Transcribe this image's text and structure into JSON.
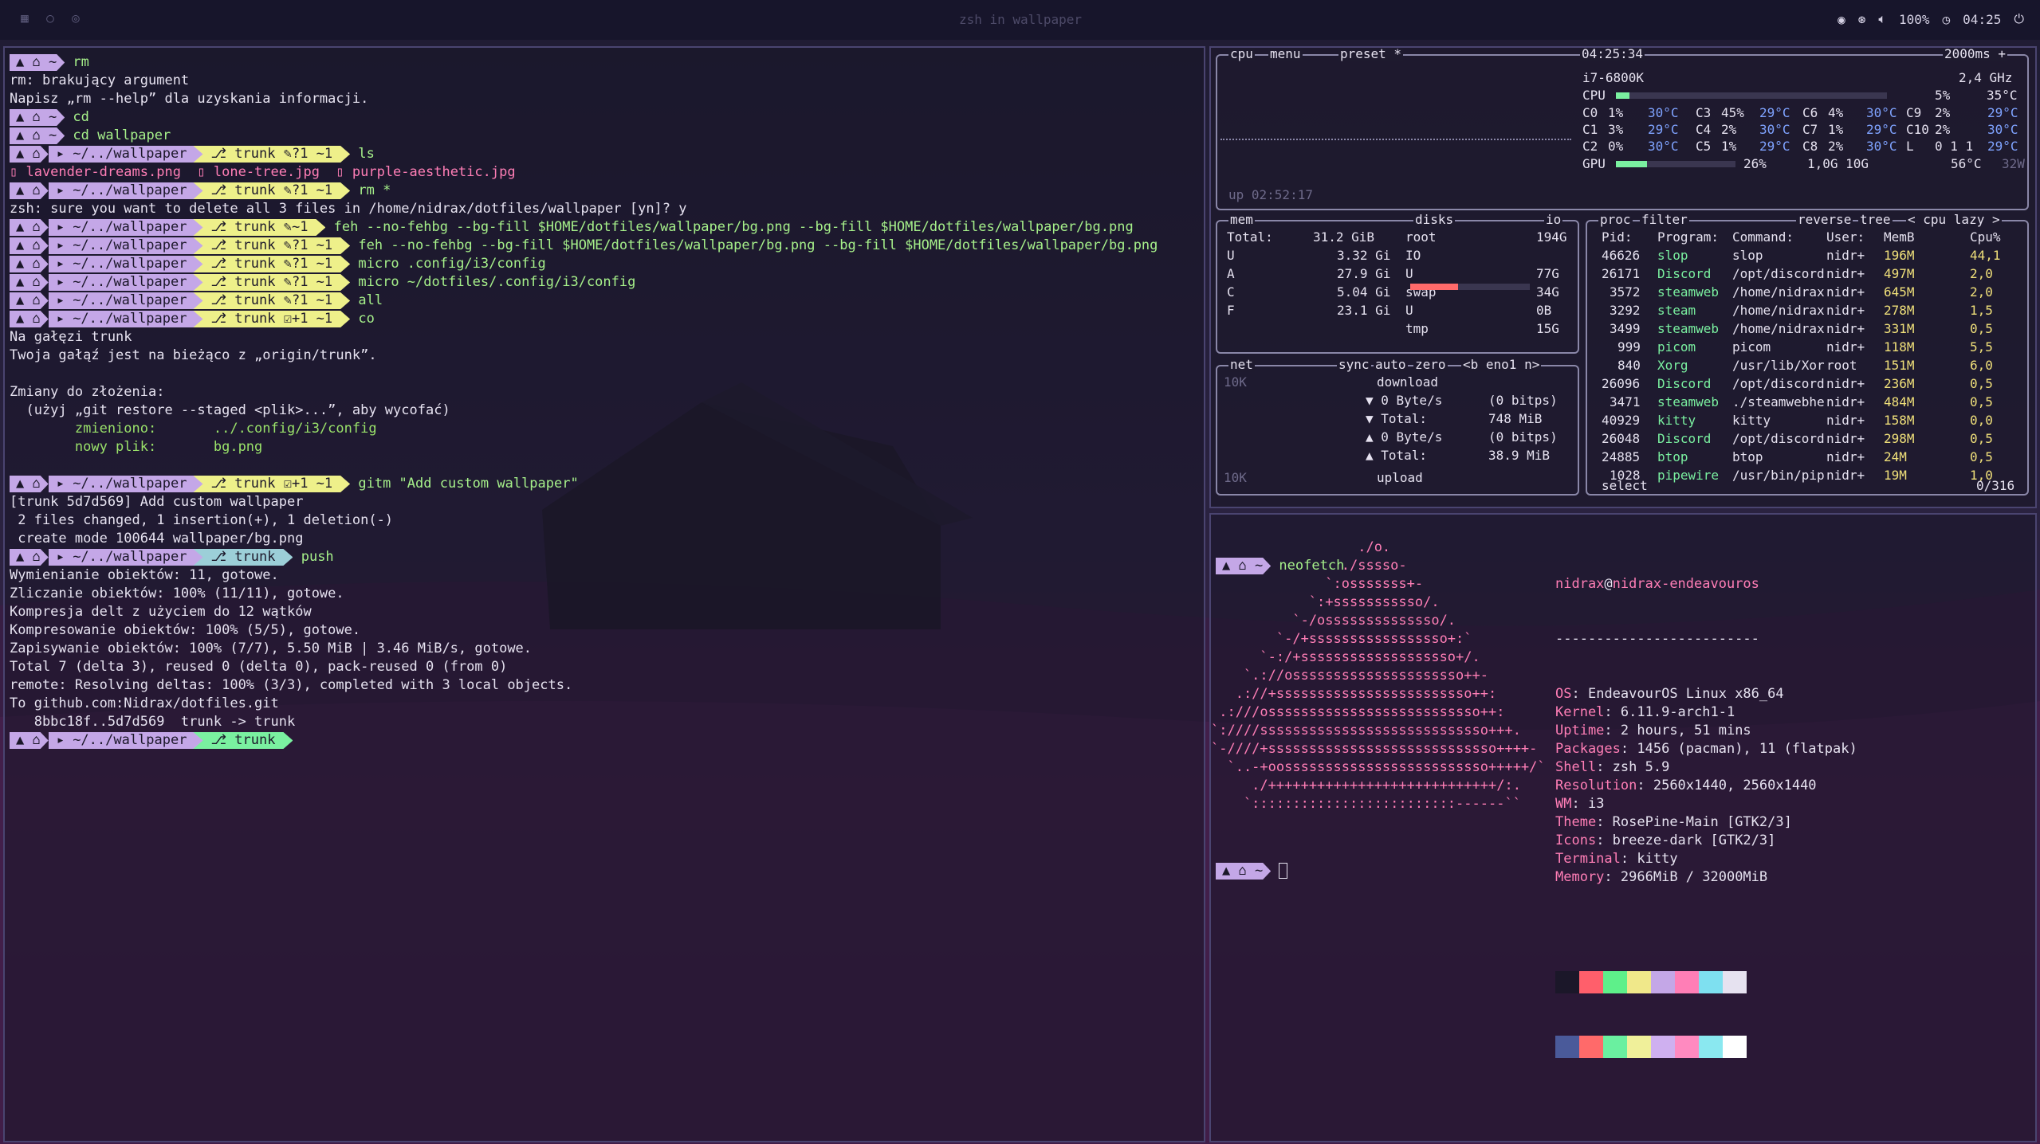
{
  "topbar": {
    "title": "zsh in wallpaper",
    "volume": "100%",
    "clock": "04:25",
    "icons": [
      "discord-icon",
      "steam-icon",
      "volume-icon",
      "clock-icon",
      "power-icon"
    ]
  },
  "left": {
    "prompt_home": "~",
    "prompt_dir": "~/../wallpaper",
    "git_branch": "trunk",
    "lines": [
      {
        "type": "prompt",
        "dir": "~",
        "cmd": "rm"
      },
      {
        "type": "out",
        "text": "rm: brakujący argument"
      },
      {
        "type": "out",
        "text": "Napisz „rm --help” dla uzyskania informacji."
      },
      {
        "type": "prompt",
        "dir": "~",
        "cmd": "cd"
      },
      {
        "type": "prompt",
        "dir": "~",
        "cmd": "cd wallpaper"
      },
      {
        "type": "prompt",
        "dir": "~/../wallpaper",
        "git": "trunk ✎?1 ~1",
        "cmd": "ls"
      },
      {
        "type": "files",
        "items": [
          "lavender-dreams.png",
          "lone-tree.jpg",
          "purple-aesthetic.jpg"
        ]
      },
      {
        "type": "prompt",
        "dir": "~/../wallpaper",
        "git": "trunk ✎?1 ~1",
        "cmd": "rm *"
      },
      {
        "type": "out",
        "text": "zsh: sure you want to delete all 3 files in /home/nidrax/dotfiles/wallpaper [yn]? y"
      },
      {
        "type": "prompt",
        "dir": "~/../wallpaper",
        "git": "trunk ✎~1",
        "cmd": "feh --no-fehbg --bg-fill $HOME/dotfiles/wallpaper/bg.png --bg-fill $HOME/dotfiles/wallpaper/bg.png"
      },
      {
        "type": "prompt",
        "dir": "~/../wallpaper",
        "git": "trunk ✎?1 ~1",
        "cmd": "feh --no-fehbg --bg-fill $HOME/dotfiles/wallpaper/bg.png --bg-fill $HOME/dotfiles/wallpaper/bg.png"
      },
      {
        "type": "prompt",
        "dir": "~/../wallpaper",
        "git": "trunk ✎?1 ~1",
        "cmd": "micro .config/i3/config"
      },
      {
        "type": "prompt",
        "dir": "~/../wallpaper",
        "git": "trunk ✎?1 ~1",
        "cmd": "micro ~/dotfiles/.config/i3/config"
      },
      {
        "type": "prompt",
        "dir": "~/../wallpaper",
        "git": "trunk ✎?1 ~1",
        "cmd": "all"
      },
      {
        "type": "prompt",
        "dir": "~/../wallpaper",
        "git": "trunk ☑+1 ~1",
        "cmd": "co"
      },
      {
        "type": "out",
        "text": "Na gałęzi trunk"
      },
      {
        "type": "out",
        "text": "Twoja gałąź jest na bieżąco z „origin/trunk”."
      },
      {
        "type": "out",
        "text": ""
      },
      {
        "type": "out",
        "text": "Zmiany do złożenia:"
      },
      {
        "type": "out",
        "text": "  (użyj „git restore --staged <plik>...”, aby wycofać)"
      },
      {
        "type": "green",
        "text": "        zmieniono:       ../.config/i3/config"
      },
      {
        "type": "green",
        "text": "        nowy plik:       bg.png"
      },
      {
        "type": "out",
        "text": ""
      },
      {
        "type": "prompt",
        "dir": "~/../wallpaper",
        "git": "trunk ☑+1 ~1",
        "cmd": "gitm \"Add custom wallpaper\""
      },
      {
        "type": "out",
        "text": "[trunk 5d7d569] Add custom wallpaper"
      },
      {
        "type": "out",
        "text": " 2 files changed, 1 insertion(+), 1 deletion(-)"
      },
      {
        "type": "out",
        "text": " create mode 100644 wallpaper/bg.png"
      },
      {
        "type": "prompt",
        "dir": "~/../wallpaper",
        "git": "trunk",
        "gitclass": "clean",
        "cmd": "push"
      },
      {
        "type": "out",
        "text": "Wymienianie obiektów: 11, gotowe."
      },
      {
        "type": "out",
        "text": "Zliczanie obiektów: 100% (11/11), gotowe."
      },
      {
        "type": "out",
        "text": "Kompresja delt z użyciem do 12 wątków"
      },
      {
        "type": "out",
        "text": "Kompresowanie obiektów: 100% (5/5), gotowe."
      },
      {
        "type": "out",
        "text": "Zapisywanie obiektów: 100% (7/7), 5.50 MiB | 3.46 MiB/s, gotowe."
      },
      {
        "type": "out",
        "text": "Total 7 (delta 3), reused 0 (delta 0), pack-reused 0 (from 0)"
      },
      {
        "type": "out",
        "text": "remote: Resolving deltas: 100% (3/3), completed with 3 local objects."
      },
      {
        "type": "out",
        "text": "To github.com:Nidrax/dotfiles.git"
      },
      {
        "type": "out",
        "text": "   8bbc18f..5d7d569  trunk -> trunk"
      },
      {
        "type": "prompt",
        "dir": "~/../wallpaper",
        "git": "trunk",
        "gitclass": "ok",
        "cmd": ""
      }
    ]
  },
  "btop": {
    "cpu_tabs": [
      "cpu",
      "menu",
      "preset *"
    ],
    "time": "04:25:34",
    "interval": "2000ms +",
    "cpu_model": "i7-6800K",
    "freq": "2,4 GHz",
    "cpu_total": {
      "label": "CPU",
      "pct": "5%",
      "temp": "35°C",
      "value": 0.05
    },
    "cores": [
      [
        "C0",
        "1%",
        "30°C",
        "C3",
        "45%",
        "29°C",
        "C6",
        "4%",
        "30°C",
        "C9",
        "2%",
        "29°C"
      ],
      [
        "C1",
        "3%",
        "29°C",
        "C4",
        "2%",
        "30°C",
        "C7",
        "1%",
        "29°C",
        "C10",
        "2%",
        "30°C"
      ],
      [
        "C2",
        "0%",
        "30°C",
        "C5",
        "1%",
        "29°C",
        "C8",
        "2%",
        "30°C",
        "L",
        "0 1 1",
        "29°C"
      ]
    ],
    "gpu": {
      "label": "GPU",
      "pct": "26%",
      "mem": "1,0G 10G",
      "temp": "56°C",
      "watt": "32W",
      "value": 0.26
    },
    "uptime": "up 02:52:17",
    "mem": {
      "title": "mem",
      "total_label": "Total:",
      "total": "31.2 GiB",
      "rows": [
        [
          "U",
          "3.32 Gi"
        ],
        [
          "A",
          "27.9 Gi"
        ],
        [
          "C",
          "5.04 Gi"
        ],
        [
          "F",
          "23.1 Gi"
        ]
      ]
    },
    "disks": {
      "title": "disks",
      "io": "io",
      "rows": [
        [
          "root",
          "194G"
        ],
        [
          "IO",
          ""
        ],
        [
          "U",
          "77G"
        ],
        [
          "swap",
          "34G"
        ],
        [
          "U",
          "0B"
        ],
        [
          "tmp",
          "15G"
        ]
      ],
      "root_used": 0.4
    },
    "net": {
      "title": "net",
      "tabs": [
        "sync",
        "auto",
        "zero",
        "<b eno1 n>"
      ],
      "scale_top": "10K",
      "scale_bottom": "10K",
      "download": "download",
      "upload": "upload",
      "rows": [
        [
          "▼ 0 Byte/s",
          "(0 bitps)"
        ],
        [
          "▼ Total:",
          "748 MiB"
        ],
        [
          "▲ 0 Byte/s",
          "(0 bitps)"
        ],
        [
          "▲ Total:",
          "38.9 MiB"
        ]
      ]
    },
    "proc": {
      "title": "proc",
      "tabs": [
        "filter",
        "reverse",
        "tree",
        "< cpu lazy >"
      ],
      "headers": [
        "Pid:",
        "Program:",
        "Command:",
        "User:",
        "MemB",
        "Cpu%"
      ],
      "rows": [
        [
          "46626",
          "slop",
          "slop",
          "nidr+",
          "196M",
          "44,1"
        ],
        [
          "26171",
          "Discord",
          "/opt/discord",
          "nidr+",
          "497M",
          "2,0"
        ],
        [
          "3572",
          "steamweb",
          "/home/nidrax",
          "nidr+",
          "645M",
          "2,0"
        ],
        [
          "3292",
          "steam",
          "/home/nidrax",
          "nidr+",
          "278M",
          "1,5"
        ],
        [
          "3499",
          "steamweb",
          "/home/nidrax",
          "nidr+",
          "331M",
          "0,5"
        ],
        [
          "999",
          "picom",
          "picom",
          "nidr+",
          "118M",
          "5,5"
        ],
        [
          "840",
          "Xorg",
          "/usr/lib/Xor",
          "root",
          "151M",
          "6,0"
        ],
        [
          "26096",
          "Discord",
          "/opt/discord",
          "nidr+",
          "236M",
          "0,5"
        ],
        [
          "3471",
          "steamweb",
          "./steamwebhe",
          "nidr+",
          "484M",
          "0,5"
        ],
        [
          "40929",
          "kitty",
          "kitty",
          "nidr+",
          "158M",
          "0,0"
        ],
        [
          "26048",
          "Discord",
          "/opt/discord",
          "nidr+",
          "298M",
          "0,5"
        ],
        [
          "24885",
          "btop",
          "btop",
          "nidr+",
          "24M",
          "0,5"
        ],
        [
          "1028",
          "pipewire",
          "/usr/bin/pip",
          "nidr+",
          "19M",
          "1,0"
        ]
      ],
      "footer_select": "select",
      "footer_count": "0/316"
    }
  },
  "neofetch": {
    "cmd": "neofetch",
    "user": "nidrax",
    "host": "nidrax-endeavouros",
    "separator": "-------------------------",
    "art": [
      "                  ./o.",
      "                ./sssso-",
      "              `:osssssss+-",
      "            `:+sssssssssso/.",
      "          `-/ossssssssssssso/.",
      "        `-/+sssssssssssssssso+:`",
      "      `-:/+sssssssssssssssssso+/.",
      "    `.://osssssssssssssssssssso++-",
      "   .://+ssssssssssssssssssssssso++:",
      " .:///ossssssssssssssssssssssssso++:",
      "`:////ssssssssssssssssssssssssssso+++.",
      "`-////+ssssssssssssssssssssssssssso++++-",
      "  `..-+oosssssssssssssssssssssssso+++++/`",
      "     ./++++++++++++++++++++++++++++/:.",
      "    `:::::::::::::::::::::::::------``"
    ],
    "info": [
      [
        "OS",
        "EndeavourOS Linux x86_64"
      ],
      [
        "Kernel",
        "6.11.9-arch1-1"
      ],
      [
        "Uptime",
        "2 hours, 51 mins"
      ],
      [
        "Packages",
        "1456 (pacman), 11 (flatpak)"
      ],
      [
        "Shell",
        "zsh 5.9"
      ],
      [
        "Resolution",
        "2560x1440, 2560x1440"
      ],
      [
        "WM",
        "i3"
      ],
      [
        "Theme",
        "RosePine-Main [GTK2/3]"
      ],
      [
        "Icons",
        "breeze-dark [GTK2/3]"
      ],
      [
        "Terminal",
        "kitty"
      ],
      [
        "Memory",
        "2966MiB / 32000MiB"
      ]
    ],
    "palette_top": [
      "#1b1729",
      "#ff5f6b",
      "#5ef08a",
      "#f0e88a",
      "#c4a7e7",
      "#ff7eb6",
      "#7ee0f0",
      "#e6e2f0"
    ],
    "palette_bottom": [
      "#4a5a9a",
      "#ff6a6a",
      "#6af0a0",
      "#f0f09a",
      "#cfb0f0",
      "#ff8ac0",
      "#8ae8f0",
      "#ffffff"
    ]
  },
  "colors": {
    "accent": "#c4a7e7",
    "pink": "#ff7eb6",
    "green": "#9ae26a",
    "yellow": "#eef08a",
    "border": "#4a4470"
  }
}
